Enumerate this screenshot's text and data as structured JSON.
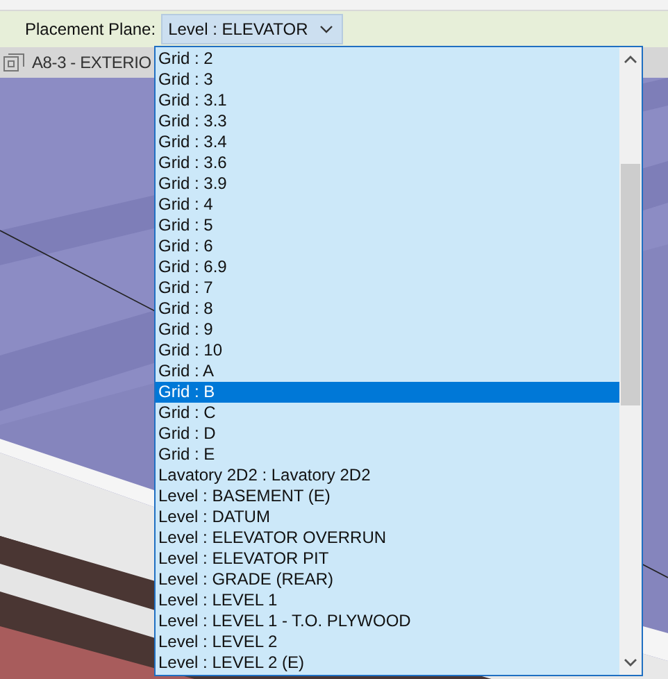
{
  "options_bar": {
    "label": "Placement Plane:",
    "dropdown": {
      "value": "Level : ELEVATOR",
      "expanded": true
    }
  },
  "view_tab": {
    "title": "A8-3 - EXTERIO"
  },
  "list": {
    "items": [
      {
        "label": "Grid : 2",
        "selected": false
      },
      {
        "label": "Grid : 3",
        "selected": false
      },
      {
        "label": "Grid : 3.1",
        "selected": false
      },
      {
        "label": "Grid : 3.3",
        "selected": false
      },
      {
        "label": "Grid : 3.4",
        "selected": false
      },
      {
        "label": "Grid : 3.6",
        "selected": false
      },
      {
        "label": "Grid : 3.9",
        "selected": false
      },
      {
        "label": "Grid : 4",
        "selected": false
      },
      {
        "label": "Grid : 5",
        "selected": false
      },
      {
        "label": "Grid : 6",
        "selected": false
      },
      {
        "label": "Grid : 6.9",
        "selected": false
      },
      {
        "label": "Grid : 7",
        "selected": false
      },
      {
        "label": "Grid : 8",
        "selected": false
      },
      {
        "label": "Grid : 9",
        "selected": false
      },
      {
        "label": "Grid : 10",
        "selected": false
      },
      {
        "label": "Grid : A",
        "selected": false
      },
      {
        "label": "Grid : B",
        "selected": true
      },
      {
        "label": "Grid : C",
        "selected": false
      },
      {
        "label": "Grid : D",
        "selected": false
      },
      {
        "label": "Grid : E",
        "selected": false
      },
      {
        "label": "Lavatory 2D2 : Lavatory 2D2",
        "selected": false
      },
      {
        "label": "Level : BASEMENT (E)",
        "selected": false
      },
      {
        "label": "Level : DATUM",
        "selected": false
      },
      {
        "label": "Level : ELEVATOR OVERRUN",
        "selected": false
      },
      {
        "label": "Level : ELEVATOR PIT",
        "selected": false
      },
      {
        "label": "Level : GRADE (REAR)",
        "selected": false
      },
      {
        "label": "Level : LEVEL 1",
        "selected": false
      },
      {
        "label": "Level : LEVEL 1 - T.O. PLYWOOD",
        "selected": false
      },
      {
        "label": "Level : LEVEL 2",
        "selected": false
      },
      {
        "label": "Level : LEVEL 2 (E)",
        "selected": false
      }
    ]
  }
}
